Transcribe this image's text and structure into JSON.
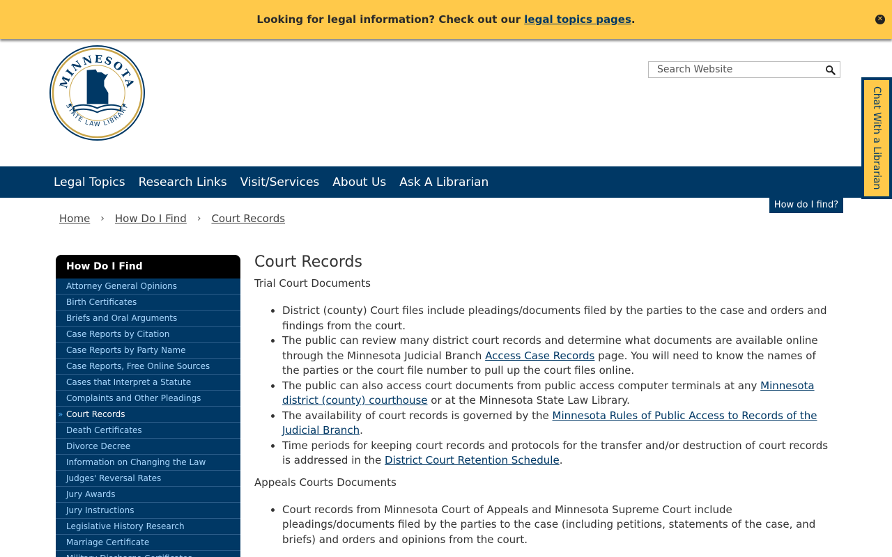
{
  "banner": {
    "text_before": "Looking for legal information? Check out our ",
    "link": "legal topics pages",
    "text_after": ".",
    "close_icon": "close-icon"
  },
  "logo": {
    "top_text": "MINNESOTA",
    "bottom_text": "STATE LAW LIBRARY",
    "colors": {
      "navy": "#003865",
      "gold": "#c9a54a"
    }
  },
  "search": {
    "placeholder": "Search Website",
    "icon": "search-icon"
  },
  "chat": {
    "label": "Chat With a Librarian"
  },
  "nav": {
    "items": [
      "Legal Topics",
      "Research Links",
      "Visit/Services",
      "About Us",
      "Ask A Librarian"
    ],
    "howdo": "How do I find?"
  },
  "breadcrumb": {
    "items": [
      "Home",
      "How Do I Find",
      "Court Records"
    ]
  },
  "sidebar": {
    "title": "How Do I Find",
    "items": [
      "Attorney General Opinions",
      "Birth Certificates",
      "Briefs and Oral Arguments",
      "Case Reports by Citation",
      "Case Reports by Party Name",
      "Case Reports, Free Online Sources",
      "Cases that Interpret a Statute",
      "Complaints and Other Pleadings",
      "Court Records",
      "Death Certificates",
      "Divorce Decree",
      "Information on Changing the Law",
      "Judges' Reversal Rates",
      "Jury Awards",
      "Jury Instructions",
      "Legislative History Research",
      "Marriage Certificate",
      "Military Discharge Certificates"
    ],
    "active": "Court Records"
  },
  "main": {
    "title": "Court Records",
    "section1": "Trial Court Documents",
    "b1": "District (county) Court files include pleadings/documents filed by the parties to the case and orders and findings from the court.",
    "b2_pre": "The public can review many district court records and determine what documents are available online through the Minnesota Judicial Branch ",
    "b2_link": "Access Case Records",
    "b2_post": " page.  You will need to know the names of the parties or the court file number to pull up the court files online.",
    "b3_pre": "The public can also access court documents from public access computer terminals at any ",
    "b3_link": "Minnesota district (county) courthouse",
    "b3_post": " or at the Minnesota State Law Library.",
    "b4_pre": "The availability of court records is governed by the ",
    "b4_link": "Minnesota Rules of Public Access to Records of the Judicial Branch",
    "b4_post": ".",
    "b5_pre": "Time periods for keeping court records and protocols for the transfer and/or destruction of court records is addressed in the ",
    "b5_link": "District Court Retention Schedule",
    "b5_post": ".",
    "section2": "Appeals Courts Documents",
    "b6": "Court records from Minnesota Court of Appeals and Minnesota Supreme Court include pleadings/documents filed by the parties to the case (including petitions, statements of the case, and briefs) and orders and opinions from the court."
  }
}
